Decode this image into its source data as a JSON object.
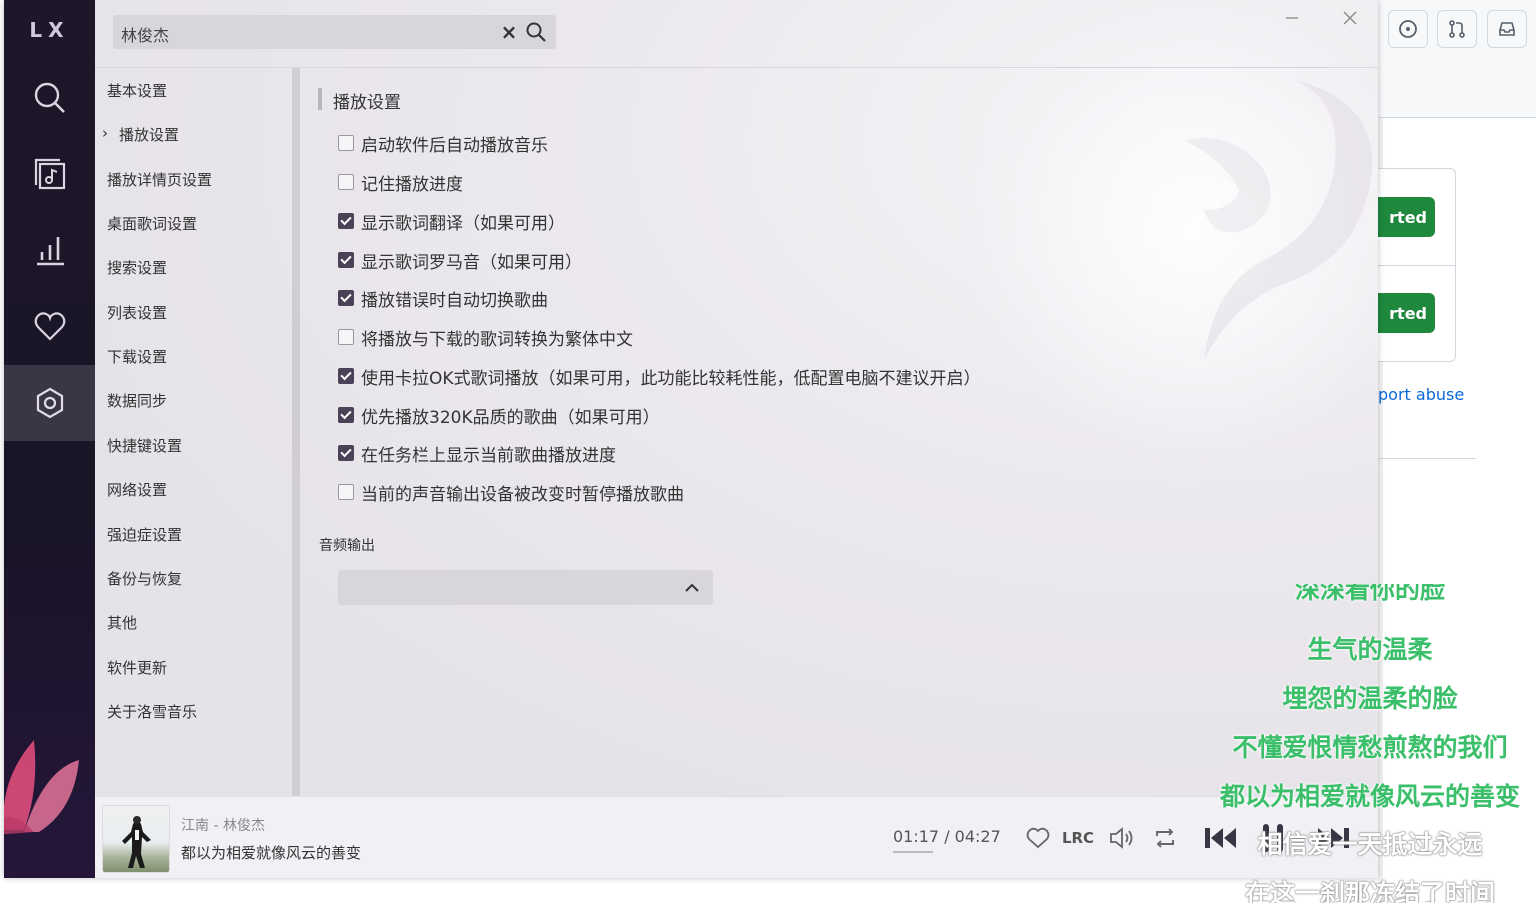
{
  "app": {
    "logo": "LX",
    "search": {
      "value": "林俊杰"
    }
  },
  "nav_icons": [
    "search-icon",
    "music-list-icon",
    "chart-icon",
    "heart-icon",
    "settings-icon"
  ],
  "settings_nav": {
    "items": [
      "基本设置",
      "播放设置",
      "播放详情页设置",
      "桌面歌词设置",
      "搜索设置",
      "列表设置",
      "下载设置",
      "数据同步",
      "快捷键设置",
      "网络设置",
      "强迫症设置",
      "备份与恢复",
      "其他",
      "软件更新",
      "关于洛雪音乐"
    ],
    "active_index": 1,
    "active_marker": "›"
  },
  "playback": {
    "section_title": "播放设置",
    "options": [
      {
        "label": "启动软件后自动播放音乐",
        "checked": false
      },
      {
        "label": "记住播放进度",
        "checked": false
      },
      {
        "label": "显示歌词翻译（如果可用）",
        "checked": true
      },
      {
        "label": "显示歌词罗马音（如果可用）",
        "checked": true
      },
      {
        "label": "播放错误时自动切换歌曲",
        "checked": true
      },
      {
        "label": "将播放与下载的歌词转换为繁体中文",
        "checked": false
      },
      {
        "label": "使用卡拉OK式歌词播放（如果可用，此功能比较耗性能，低配置电脑不建议开启）",
        "checked": true
      },
      {
        "label": "优先播放320K品质的歌曲（如果可用）",
        "checked": true
      },
      {
        "label": "在任务栏上显示当前歌曲播放进度",
        "checked": true
      },
      {
        "label": "当前的声音输出设备被改变时暂停播放歌曲",
        "checked": false
      }
    ],
    "audio_output_label": "音频输出",
    "audio_output_value": ""
  },
  "player": {
    "meta": "江南 - 林俊杰",
    "lyric": "都以为相爱就像风云的善变",
    "time": "01:17 / 04:27",
    "progress": 0.29,
    "lrc_label": "LRC"
  },
  "desktop_lyrics": {
    "cut_line": "深深看你的脸",
    "green_lines": [
      "生气的温柔",
      "埋怨的温柔的脸",
      "不懂爱恨情愁煎熬的我们",
      "都以为相爱就像风云的善变"
    ],
    "white_lines": [
      "相信爱一天抵过永远",
      "在这一刹那冻结了时间"
    ]
  },
  "background_page": {
    "button_text": "rted",
    "link_text": "port abuse",
    "colors": {
      "button": "#1f883d",
      "link": "#0969da"
    }
  },
  "colors": {
    "accent_check": "#4a4357",
    "lyric_green": "#3bbf6a",
    "nav_bg": "#1d1729"
  }
}
